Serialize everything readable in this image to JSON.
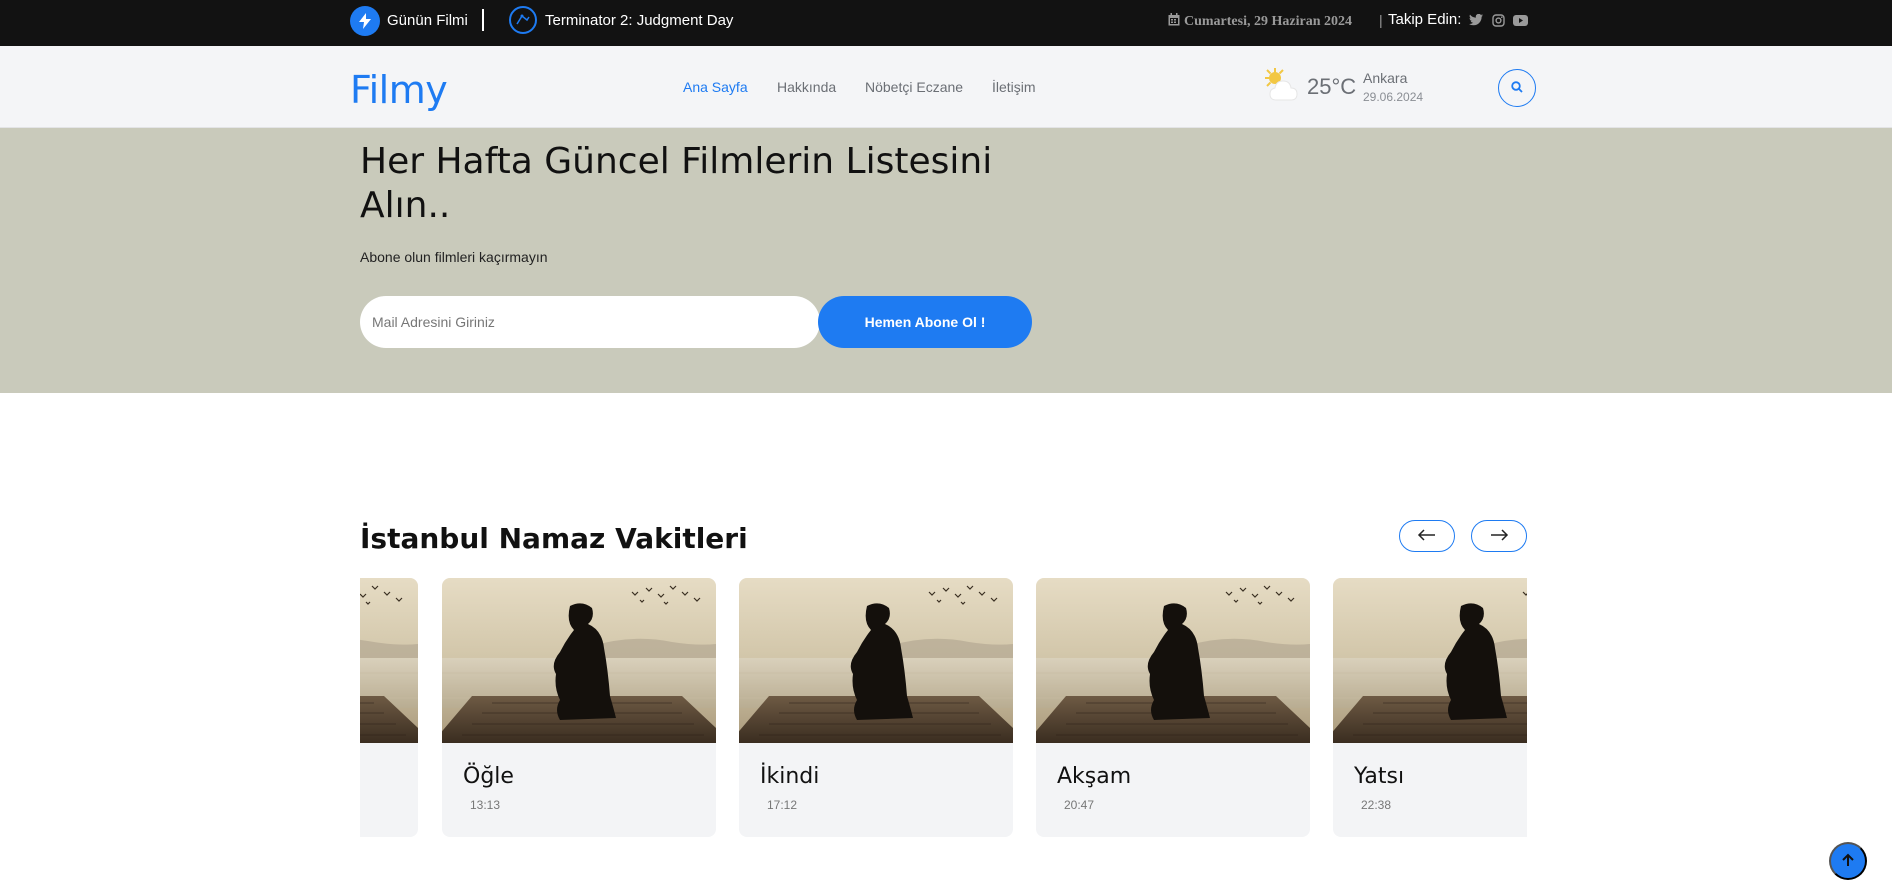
{
  "topbar": {
    "film_label": "Günün Filmi",
    "film_title": "Terminator 2: Judgment Day",
    "date": "Cumartesi, 29 Haziran 2024",
    "date_sep": "|",
    "follow_label": "Takip Edin:",
    "social_icons": [
      "twitter-icon",
      "instagram-icon",
      "youtube-icon"
    ]
  },
  "nav": {
    "logo": "Filmy",
    "items": [
      {
        "label": "Ana Sayfa",
        "active": true
      },
      {
        "label": "Hakkında",
        "active": false
      },
      {
        "label": "Nöbetçi Eczane",
        "active": false
      },
      {
        "label": "İletişim",
        "active": false
      }
    ],
    "weather": {
      "temp": "25°C",
      "city": "Ankara",
      "date": "29.06.2024"
    }
  },
  "hero": {
    "title": "Her Hafta Güncel Filmlerin Listesini Alın..",
    "subtitle": "Abone olun filmleri kaçırmayın",
    "input_placeholder": "Mail Adresini Giriniz",
    "button_label": "Hemen Abone Ol !"
  },
  "prayer": {
    "title": "İstanbul Namaz Vakitleri",
    "cards": [
      {
        "name": "",
        "time": ""
      },
      {
        "name": "Öğle",
        "time": "13:13"
      },
      {
        "name": "İkindi",
        "time": "17:12"
      },
      {
        "name": "Akşam",
        "time": "20:47"
      },
      {
        "name": "Yatsı",
        "time": "22:38"
      }
    ]
  },
  "colors": {
    "accent": "#1e7bf2",
    "topbar_bg": "#121212",
    "navbar_bg": "#f4f5f7",
    "hero_bg": "#c9cabb",
    "card_bg": "#f3f4f6"
  }
}
